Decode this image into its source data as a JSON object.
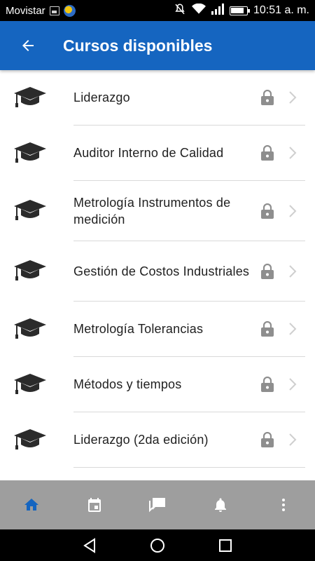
{
  "status_bar": {
    "carrier": "Movistar",
    "time": "10:51 a. m."
  },
  "app_bar": {
    "title": "Cursos disponibles",
    "color": "#1565c0"
  },
  "courses": [
    {
      "label": "Liderazgo",
      "locked": true
    },
    {
      "label": "Auditor Interno de Calidad",
      "locked": true
    },
    {
      "label": "Metrología Instrumentos de medición",
      "locked": true
    },
    {
      "label": "Gestión de Costos Industriales",
      "locked": true
    },
    {
      "label": "Metrología Tolerancias",
      "locked": true
    },
    {
      "label": "Métodos y tiempos",
      "locked": true
    },
    {
      "label": "Liderazgo (2da edición)",
      "locked": true
    }
  ],
  "icons": {
    "course": "graduation-cap-icon",
    "lock": "lock-icon",
    "chevron": "chevron-right-icon"
  },
  "bottom_nav": {
    "items": [
      "home-icon",
      "calendar-icon",
      "messages-icon",
      "bell-icon",
      "more-vert-icon"
    ],
    "active_color": "#1565c0",
    "inactive_color": "#ffffff",
    "background": "#9e9e9e"
  }
}
